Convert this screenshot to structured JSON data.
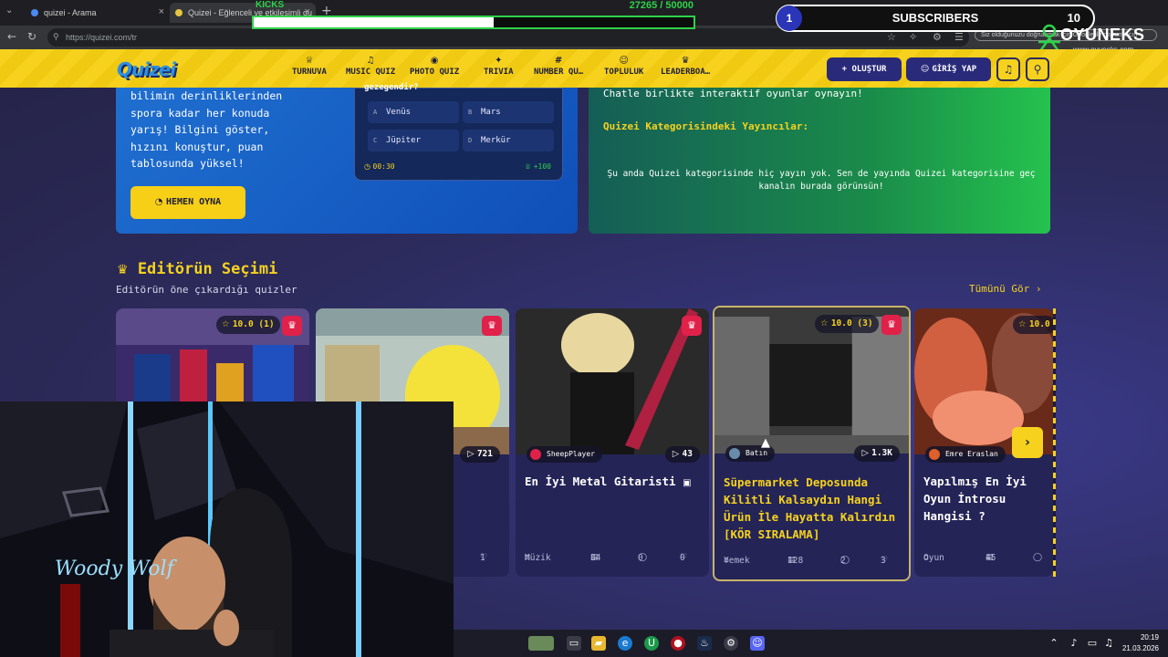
{
  "browser": {
    "tabs": [
      {
        "title": "quizei - Arama",
        "active": false
      },
      {
        "title": "Quizei - Eğlenceli ve etkileşimli qu",
        "active": true
      }
    ],
    "url": "https://quizei.com/tr",
    "url_hint": "Siz olduğunuzu doğrulamak için Google ile oturum açın"
  },
  "overlay": {
    "kicks_label": "KICKS",
    "kicks_count": "27265",
    "kicks_goal": "/ 50000",
    "kicks_progress": 0.545,
    "subs_level": "1",
    "subs_label": "SUBSCRIBERS",
    "subs_goal": "10",
    "subs_progress": 0.05,
    "brand_name": "OYUNEKS",
    "brand_url": "www.oyuneks.com"
  },
  "header": {
    "logo": "Quizei",
    "nav": [
      {
        "icon": "trophy-icon",
        "glyph": "♕",
        "label": "TURNUVA"
      },
      {
        "icon": "music-icon",
        "glyph": "♫",
        "label": "MUSIC QUIZ"
      },
      {
        "icon": "camera-icon",
        "glyph": "◉",
        "label": "PHOTO QUIZ"
      },
      {
        "icon": "bulb-icon",
        "glyph": "✦",
        "label": "TRIVIA"
      },
      {
        "icon": "hash-icon",
        "glyph": "#",
        "label": "NUMBER QU…"
      },
      {
        "icon": "users-icon",
        "glyph": "☺",
        "label": "TOPLULUK"
      },
      {
        "icon": "trophy-icon",
        "glyph": "♛",
        "label": "LEADERBOA…"
      }
    ],
    "create_label": "+ OLUŞTUR",
    "login_label": "GİRİŞ YAP"
  },
  "hero": {
    "text": "bilimin derinliklerinden spora kadar her konuda yarış! Bilgini göster, hızını konuştur, puan tablosunda yüksel!",
    "play_label": "HEMEN OYNA",
    "quiz_question": "gezegendir?",
    "options": [
      {
        "letter": "A",
        "text": "Venüs"
      },
      {
        "letter": "B",
        "text": "Mars"
      },
      {
        "letter": "C",
        "text": "Jüpiter"
      },
      {
        "letter": "D",
        "text": "Merkür"
      }
    ],
    "timer": "00:30",
    "points": "+100"
  },
  "stream_panel": {
    "text": "Chatle birlikte interaktif oyunlar oynayın!",
    "title": "Quizei Kategorisindeki Yayıncılar:",
    "message": "Şu anda Quizei kategorisinde hiç yayın yok. Sen de yayında Quizei kategorisine geç kanalın burada görünsün!"
  },
  "editors": {
    "title": "Editörün Seçimi",
    "subtitle": "Editörün öne çıkardığı quizler",
    "see_all": "Tümünü Gör ›",
    "cards": [
      {
        "rating": "10.0 (1)",
        "author": "",
        "plays": "",
        "title": "",
        "category": "",
        "questions": "",
        "comments": "",
        "likes": ""
      },
      {
        "rating": "",
        "author": "",
        "plays": "721",
        "title": "",
        "category": "",
        "questions": "",
        "comments": "",
        "likes": "1"
      },
      {
        "rating": "",
        "author": "SheepPlayer",
        "plays": "43",
        "title": "En İyi Metal Gitaristi",
        "category": "Müzik",
        "questions": "84",
        "comments": "0",
        "likes": "0"
      },
      {
        "rating": "10.0 (3)",
        "author": "Batın",
        "plays": "1.3K",
        "title": "Süpermarket Deposunda Kilitli Kalsaydın Hangi Ürün İle Hayatta Kalırdın [KÖR SIRALAMA]",
        "category": "Yemek",
        "questions": "128",
        "comments": "2",
        "likes": "3"
      },
      {
        "rating": "10.0",
        "author": "Emre Eraslan",
        "plays": "",
        "title": "Yapılmış En İyi Oyun İntrosu Hangisi ?",
        "category": "Oyun",
        "questions": "45",
        "comments": "",
        "likes": ""
      }
    ]
  },
  "webcam": {
    "neon_text": "Woody Wolf"
  },
  "taskbar": {
    "time": "20:19",
    "date": "21.03.2026"
  },
  "colors": {
    "accent": "#f6d21e",
    "navy": "#2a2a7a",
    "card": "#242457",
    "crown": "#e0214a"
  }
}
